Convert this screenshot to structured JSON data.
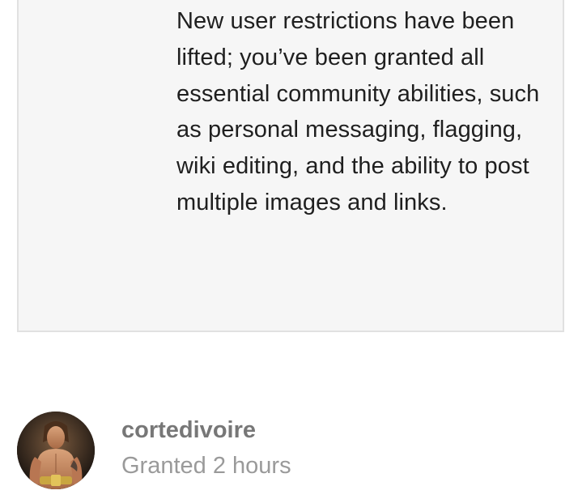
{
  "notice": {
    "text": "New user restrictions have been lifted; you’ve been granted all essential community abilities, such as personal messaging, flagging, wiki editing, and the ability to post multiple images and links."
  },
  "user": {
    "name": "cortedivoire",
    "granted": "Granted 2 hours",
    "avatar_icon": "wrestler-avatar"
  },
  "colors": {
    "card_bg": "#f6f6f6",
    "card_border": "#e1e1e1",
    "text": "#1f1f1f",
    "username": "#777777",
    "meta": "#9a9a9a"
  }
}
